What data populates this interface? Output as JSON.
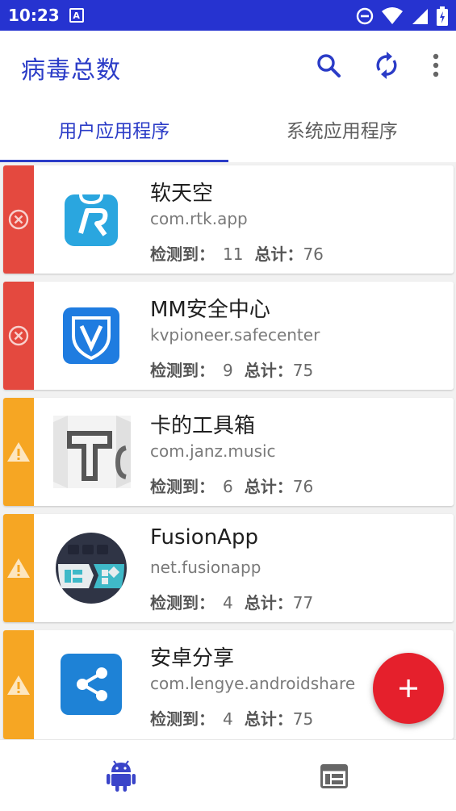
{
  "status_bar": {
    "time": "10:23"
  },
  "app_bar": {
    "title": "病毒总数"
  },
  "tabs": [
    {
      "label": "用户应用程序",
      "active": true
    },
    {
      "label": "系统应用程序",
      "active": false
    }
  ],
  "list_labels": {
    "detected": "检测到：",
    "total": "总计："
  },
  "apps": [
    {
      "name": "软天空",
      "package": "com.rtk.app",
      "detected": "11",
      "total": "76",
      "status": "danger",
      "status_icon": "error-circle-icon",
      "logo": "rtk-logo-icon"
    },
    {
      "name": "MM安全中心",
      "package": "kvpioneer.safecenter",
      "detected": "9",
      "total": "75",
      "status": "danger",
      "status_icon": "error-circle-icon",
      "logo": "shield-v-logo-icon"
    },
    {
      "name": "卡的工具箱",
      "package": "com.janz.music",
      "detected": "6",
      "total": "76",
      "status": "warn",
      "status_icon": "warning-triangle-icon",
      "logo": "t-logo-icon"
    },
    {
      "name": "FusionApp",
      "package": "net.fusionapp",
      "detected": "4",
      "total": "77",
      "status": "warn",
      "status_icon": "warning-triangle-icon",
      "logo": "fusionapp-logo-icon"
    },
    {
      "name": "安卓分享",
      "package": "com.lengye.androidshare",
      "detected": "4",
      "total": "75",
      "status": "warn",
      "status_icon": "warning-triangle-icon",
      "logo": "share-logo-icon"
    }
  ],
  "colors": {
    "primary": "#2b3cc7",
    "danger": "#e4493f",
    "warn": "#f6a623",
    "fab": "#e5202c"
  }
}
